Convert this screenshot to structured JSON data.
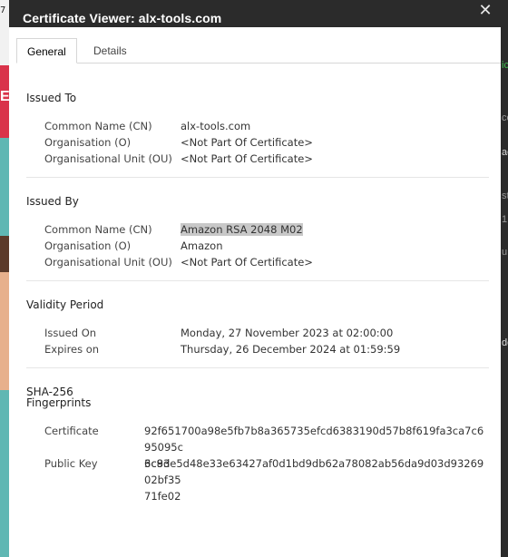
{
  "window": {
    "title": "Certificate Viewer: alx-tools.com",
    "close_icon": "close-icon"
  },
  "tabs": [
    {
      "label": "General",
      "active": true
    },
    {
      "label": "Details",
      "active": false
    }
  ],
  "issued_to": {
    "heading": "Issued To",
    "rows": [
      {
        "label": "Common Name (CN)",
        "value": "alx-tools.com"
      },
      {
        "label": "Organisation (O)",
        "value": "<Not Part Of Certificate>"
      },
      {
        "label": "Organisational Unit (OU)",
        "value": "<Not Part Of Certificate>"
      }
    ]
  },
  "issued_by": {
    "heading": "Issued By",
    "rows": [
      {
        "label": "Common Name (CN)",
        "value": "Amazon RSA 2048 M02"
      },
      {
        "label": "Organisation (O)",
        "value": "Amazon"
      },
      {
        "label": "Organisational Unit (OU)",
        "value": "<Not Part Of Certificate>"
      }
    ]
  },
  "validity": {
    "heading": "Validity Period",
    "rows": [
      {
        "label": "Issued On",
        "value": "Monday, 27 November 2023 at 02:00:00"
      },
      {
        "label": "Expires on",
        "value": "Thursday, 26 December 2024 at 01:59:59"
      }
    ]
  },
  "fingerprints": {
    "heading_line1": "SHA-256",
    "heading_line2": "Fingerprints",
    "rows": [
      {
        "label": "Certificate",
        "line1": "92f651700a98e5fb7b8a365735efcd6383190d57b8f619fa3ca7c695095c",
        "line2": "3c8d"
      },
      {
        "label": "Public Key",
        "line1": "6c93e5d48e33e63427af0d1bd9db62a78082ab56da9d03d9326902bf35",
        "line2": "71fe02"
      }
    ]
  },
  "background": {
    "left_top_text": "7",
    "left_banner_text": "E",
    "right_texts": [
      "ic",
      "co",
      "ae",
      "st",
      "1",
      "u",
      "de"
    ]
  }
}
